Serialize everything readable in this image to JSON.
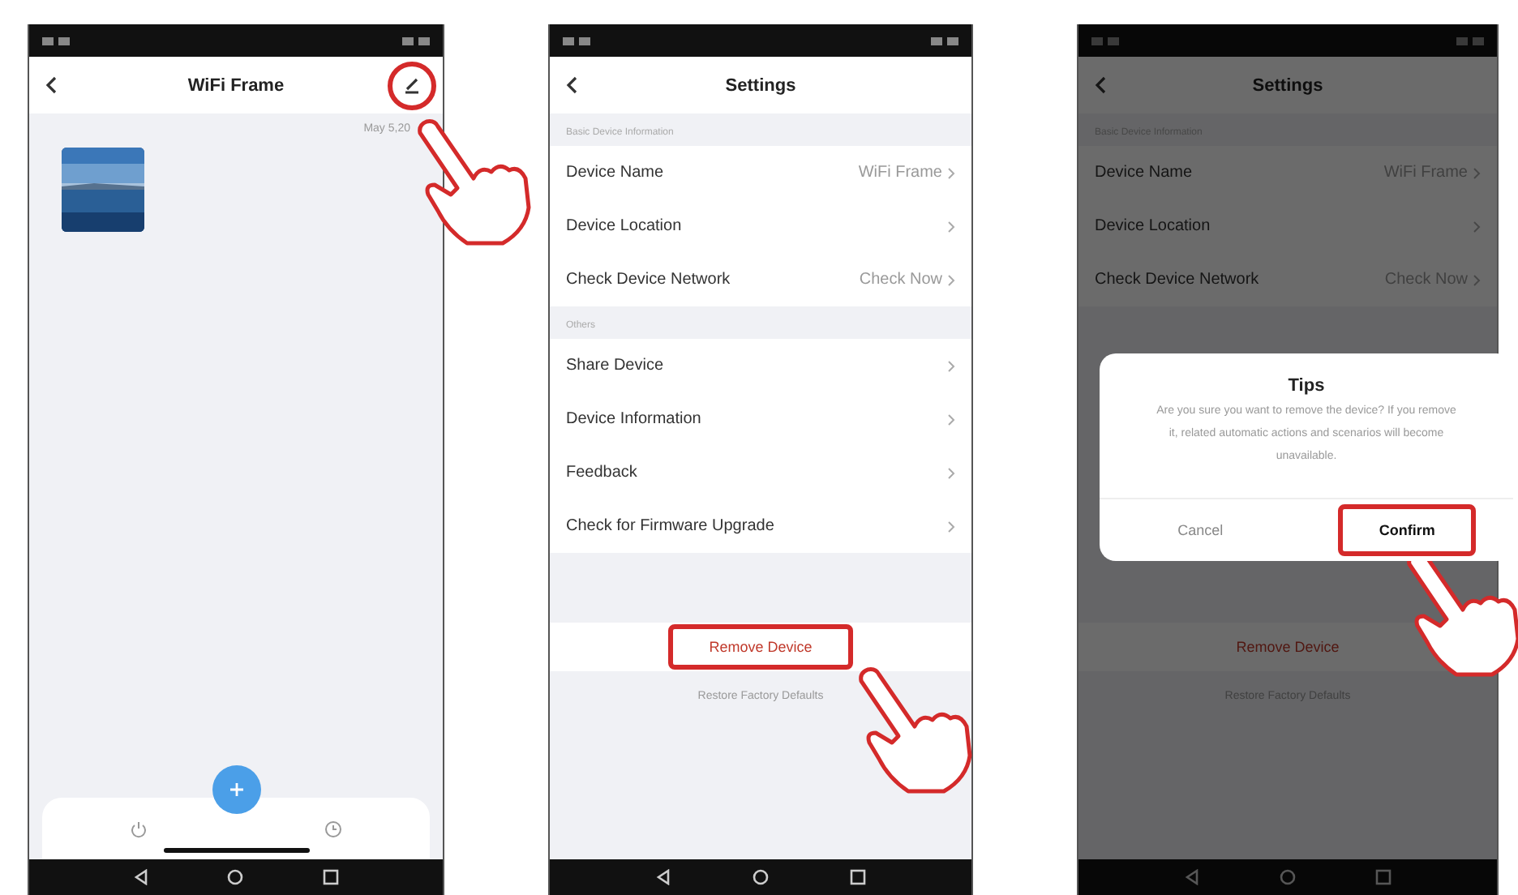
{
  "screens": [
    {
      "kind": "frame",
      "title": "WiFi Frame",
      "dimmed": false,
      "edit_highlighted": true,
      "date": "May 5,20"
    },
    {
      "kind": "settings",
      "title": "Settings",
      "dimmed": false,
      "sections": [
        {
          "header": "Basic Device Information",
          "rows": [
            {
              "label": "Device Name",
              "value": "WiFi Frame"
            },
            {
              "label": "Device Location"
            },
            {
              "label": "Check Device Network",
              "value": "Check Now"
            }
          ]
        },
        {
          "header": "Others",
          "rows": [
            {
              "label": "Share Device"
            },
            {
              "label": "Device Information"
            },
            {
              "label": "Feedback"
            },
            {
              "label": "Check for Firmware Upgrade"
            }
          ]
        }
      ],
      "remove": {
        "label": "Remove Device",
        "highlighted": true
      },
      "restore": "Restore Factory Defaults"
    },
    {
      "kind": "settings",
      "title": "Settings",
      "dimmed": true,
      "sections": [
        {
          "header": "Basic Device Information",
          "rows": [
            {
              "label": "Device Name",
              "value": "WiFi Frame"
            },
            {
              "label": "Device Location"
            },
            {
              "label": "Check Device Network",
              "value": "Check Now"
            }
          ]
        }
      ],
      "remove": {
        "label": "Remove Device",
        "highlighted": false
      },
      "restore": "Restore Factory Defaults",
      "dialog": {
        "title": "Tips",
        "message": "Are you sure you want to remove the device? If you remove it, related automatic actions and scenarios will become unavailable.",
        "buttons": [
          {
            "label": "Cancel",
            "highlighted": false
          },
          {
            "label": "Confirm",
            "highlighted": true
          }
        ]
      }
    }
  ]
}
